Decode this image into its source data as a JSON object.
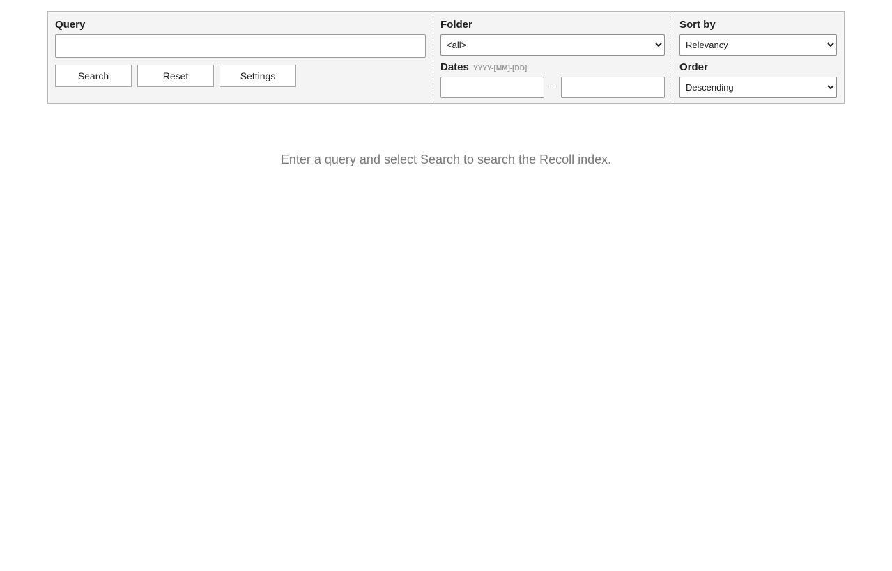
{
  "query": {
    "label": "Query",
    "value": "",
    "buttons": {
      "search": "Search",
      "reset": "Reset",
      "settings": "Settings"
    }
  },
  "folder": {
    "label": "Folder",
    "selected": "<all>"
  },
  "dates": {
    "label": "Dates",
    "format_hint": "YYYY-[MM]-[DD]",
    "separator": "–",
    "from_value": "",
    "to_value": ""
  },
  "sort": {
    "label": "Sort by",
    "selected": "Relevancy"
  },
  "order": {
    "label": "Order",
    "selected": "Descending"
  },
  "main": {
    "message": "Enter a query and select Search to search the Recoll index."
  }
}
